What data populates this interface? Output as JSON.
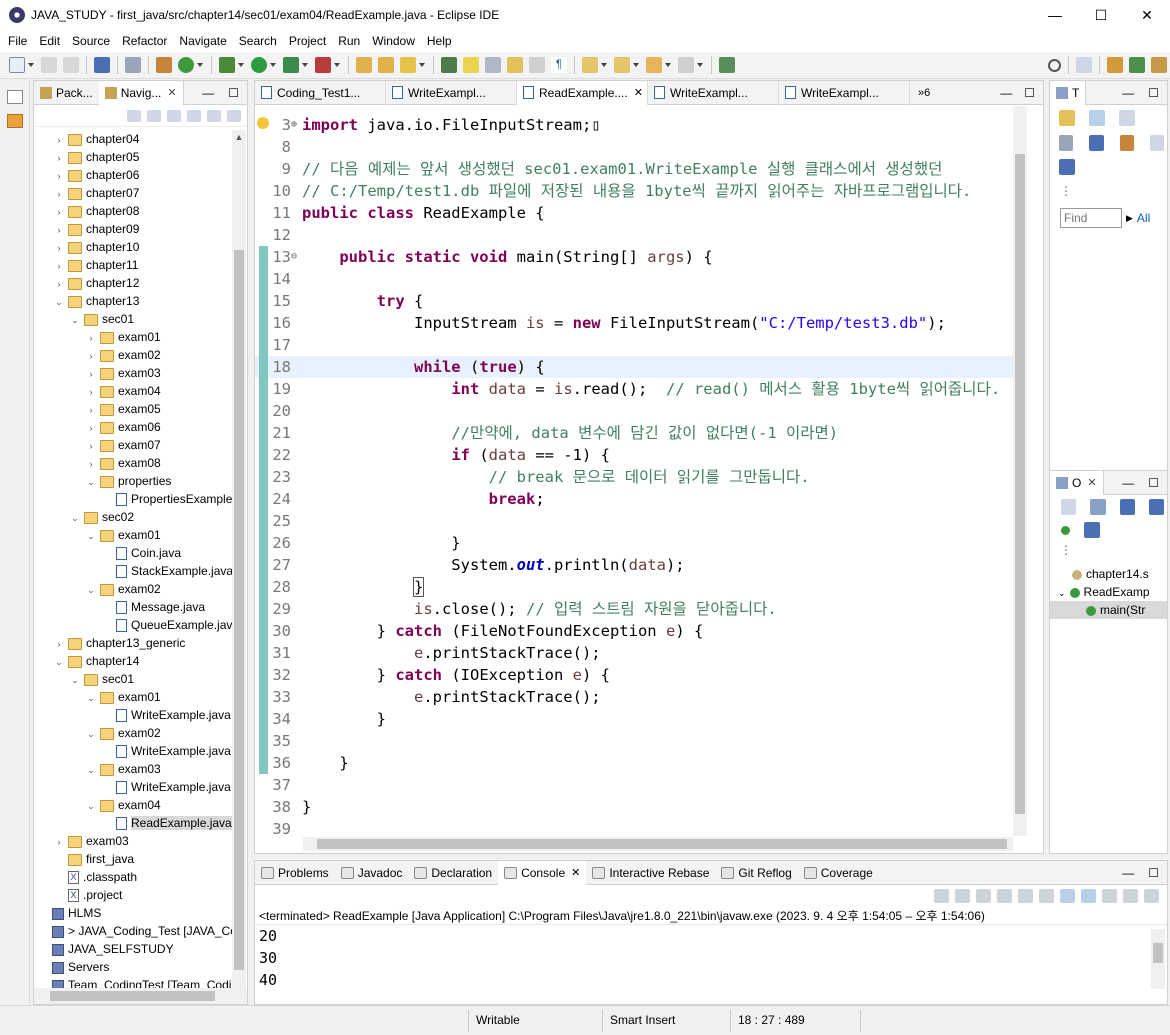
{
  "window": {
    "title": "JAVA_STUDY - first_java/src/chapter14/sec01/exam04/ReadExample.java - Eclipse IDE",
    "minimize": "—",
    "maximize": "☐",
    "close": "✕"
  },
  "menu": [
    "File",
    "Edit",
    "Source",
    "Refactor",
    "Navigate",
    "Search",
    "Project",
    "Run",
    "Window",
    "Help"
  ],
  "explorer": {
    "tabs": [
      {
        "label": "Pack..."
      },
      {
        "label": "Navig..."
      }
    ],
    "close_glyph": "✕",
    "tree": [
      {
        "label": "chapter04",
        "depth": 1,
        "type": "folder",
        "twisty": "›"
      },
      {
        "label": "chapter05",
        "depth": 1,
        "type": "folder",
        "twisty": "›"
      },
      {
        "label": "chapter06",
        "depth": 1,
        "type": "folder",
        "twisty": "›"
      },
      {
        "label": "chapter07",
        "depth": 1,
        "type": "folder",
        "twisty": "›"
      },
      {
        "label": "chapter08",
        "depth": 1,
        "type": "folder",
        "twisty": "›"
      },
      {
        "label": "chapter09",
        "depth": 1,
        "type": "folder",
        "twisty": "›"
      },
      {
        "label": "chapter10",
        "depth": 1,
        "type": "folder",
        "twisty": "›"
      },
      {
        "label": "chapter11",
        "depth": 1,
        "type": "folder",
        "twisty": "›"
      },
      {
        "label": "chapter12",
        "depth": 1,
        "type": "folder",
        "twisty": "›"
      },
      {
        "label": "chapter13",
        "depth": 1,
        "type": "folder",
        "twisty": "⌄"
      },
      {
        "label": "sec01",
        "depth": 2,
        "type": "folder",
        "twisty": "⌄"
      },
      {
        "label": "exam01",
        "depth": 3,
        "type": "folder",
        "twisty": "›"
      },
      {
        "label": "exam02",
        "depth": 3,
        "type": "folder",
        "twisty": "›"
      },
      {
        "label": "exam03",
        "depth": 3,
        "type": "folder",
        "twisty": "›"
      },
      {
        "label": "exam04",
        "depth": 3,
        "type": "folder",
        "twisty": "›"
      },
      {
        "label": "exam05",
        "depth": 3,
        "type": "folder",
        "twisty": "›"
      },
      {
        "label": "exam06",
        "depth": 3,
        "type": "folder",
        "twisty": "›"
      },
      {
        "label": "exam07",
        "depth": 3,
        "type": "folder",
        "twisty": "›"
      },
      {
        "label": "exam08",
        "depth": 3,
        "type": "folder",
        "twisty": "›"
      },
      {
        "label": "properties",
        "depth": 3,
        "type": "folder",
        "twisty": "⌄"
      },
      {
        "label": "PropertiesExample.",
        "depth": 4,
        "type": "file",
        "twisty": ""
      },
      {
        "label": "sec02",
        "depth": 2,
        "type": "folder",
        "twisty": "⌄"
      },
      {
        "label": "exam01",
        "depth": 3,
        "type": "folder",
        "twisty": "⌄"
      },
      {
        "label": "Coin.java",
        "depth": 4,
        "type": "file",
        "twisty": ""
      },
      {
        "label": "StackExample.java",
        "depth": 4,
        "type": "file",
        "twisty": ""
      },
      {
        "label": "exam02",
        "depth": 3,
        "type": "folder",
        "twisty": "⌄"
      },
      {
        "label": "Message.java",
        "depth": 4,
        "type": "file",
        "twisty": ""
      },
      {
        "label": "QueueExample.java",
        "depth": 4,
        "type": "file",
        "twisty": ""
      },
      {
        "label": "chapter13_generic",
        "depth": 1,
        "type": "folder",
        "twisty": "›"
      },
      {
        "label": "chapter14",
        "depth": 1,
        "type": "folder",
        "twisty": "⌄"
      },
      {
        "label": "sec01",
        "depth": 2,
        "type": "folder",
        "twisty": "⌄"
      },
      {
        "label": "exam01",
        "depth": 3,
        "type": "folder",
        "twisty": "⌄"
      },
      {
        "label": "WriteExample.java",
        "depth": 4,
        "type": "file",
        "twisty": ""
      },
      {
        "label": "exam02",
        "depth": 3,
        "type": "folder",
        "twisty": "⌄"
      },
      {
        "label": "WriteExample.java",
        "depth": 4,
        "type": "file",
        "twisty": ""
      },
      {
        "label": "exam03",
        "depth": 3,
        "type": "folder",
        "twisty": "⌄"
      },
      {
        "label": "WriteExample.java",
        "depth": 4,
        "type": "file",
        "twisty": ""
      },
      {
        "label": "exam04",
        "depth": 3,
        "type": "folder",
        "twisty": "⌄"
      },
      {
        "label": "ReadExample.java",
        "depth": 4,
        "type": "file",
        "twisty": "",
        "selected": true
      },
      {
        "label": "exam03",
        "depth": 1,
        "type": "folder",
        "twisty": "›"
      },
      {
        "label": "first_java",
        "depth": 1,
        "type": "folder",
        "twisty": ""
      },
      {
        "label": ".classpath",
        "depth": 1,
        "type": "xfile",
        "twisty": ""
      },
      {
        "label": ".project",
        "depth": 1,
        "type": "xfile",
        "twisty": ""
      },
      {
        "label": "HLMS",
        "depth": 0,
        "type": "project",
        "twisty": ""
      },
      {
        "label": "> JAVA_Coding_Test [JAVA_Codir",
        "depth": 0,
        "type": "project",
        "twisty": ""
      },
      {
        "label": "JAVA_SELFSTUDY",
        "depth": 0,
        "type": "project",
        "twisty": ""
      },
      {
        "label": "Servers",
        "depth": 0,
        "type": "project",
        "twisty": ""
      },
      {
        "label": "Team_CodingTest [Team_CodingT",
        "depth": 0,
        "type": "project",
        "twisty": ""
      }
    ]
  },
  "editor": {
    "tabs": [
      {
        "label": "Coding_Test1...",
        "active": false
      },
      {
        "label": "WriteExampl...",
        "active": false
      },
      {
        "label": "ReadExample....",
        "active": true
      },
      {
        "label": "WriteExampl...",
        "active": false
      },
      {
        "label": "WriteExampl...",
        "active": false
      }
    ],
    "overflow": "»6",
    "close_glyph": "✕",
    "lines": [
      {
        "n": "3",
        "marker": "⊕",
        "html": "<span class=\"kw\">import</span> java.io.FileInputStream;▯"
      },
      {
        "n": "8",
        "html": ""
      },
      {
        "n": "9",
        "html": "<span class=\"cm\">// 다음 예제는 앞서 생성했던 sec01.exam01.WriteExample 실행 클래스에서 생성했던</span>"
      },
      {
        "n": "10",
        "html": "<span class=\"cm\">// C:/Temp/test1.db 파일에 저장된 내용을 1byte씩 끝까지 읽어주는 자바프로그램입니다.</span>"
      },
      {
        "n": "11",
        "html": "<span class=\"kw\">public class</span> ReadExample {"
      },
      {
        "n": "12",
        "html": ""
      },
      {
        "n": "13",
        "marker": "⊖",
        "html": "    <span class=\"kw\">public static void</span> main(String[] <span class=\"var\">args</span>) {"
      },
      {
        "n": "14",
        "html": ""
      },
      {
        "n": "15",
        "html": "        <span class=\"kw\">try</span> {"
      },
      {
        "n": "16",
        "html": "            InputStream <span class=\"var\">is</span> = <span class=\"kw\">new</span> FileInputStream(<span class=\"str\">\"C:/Temp/test3.db\"</span>);"
      },
      {
        "n": "17",
        "html": ""
      },
      {
        "n": "18",
        "current": true,
        "html": "            <span class=\"kw\">while</span> (<span class=\"kw\">true</span>) {"
      },
      {
        "n": "19",
        "html": "                <span class=\"kw\">int</span> <span class=\"var\">data</span> = <span class=\"var\">is</span>.read();  <span class=\"cm\">// read() 메서스 활용 1byte씩 읽어줍니다.</span>"
      },
      {
        "n": "20",
        "html": ""
      },
      {
        "n": "21",
        "html": "                <span class=\"cm\">//만약에, data 변수에 담긴 값이 없다면(-1 이라면)</span>"
      },
      {
        "n": "22",
        "html": "                <span class=\"kw\">if</span> (<span class=\"var\">data</span> == -1) {"
      },
      {
        "n": "23",
        "html": "                    <span class=\"cm\">// break 문으로 데이터 읽기를 그만둡니다.</span>"
      },
      {
        "n": "24",
        "html": "                    <span class=\"kw\">break</span>;"
      },
      {
        "n": "25",
        "html": ""
      },
      {
        "n": "26",
        "html": "                }"
      },
      {
        "n": "27",
        "html": "                System.<span class=\"fld\">out</span>.println(<span class=\"var\">data</span>);"
      },
      {
        "n": "28",
        "html": "            <span style=\"outline:1px solid #555\">}</span>"
      },
      {
        "n": "29",
        "html": "            <span class=\"var\">is</span>.close(); <span class=\"cm\">// 입력 스트림 자원을 닫아줍니다.</span>"
      },
      {
        "n": "30",
        "html": "        } <span class=\"kw\">catch</span> (FileNotFoundException <span class=\"var\">e</span>) {"
      },
      {
        "n": "31",
        "html": "            <span class=\"var\">e</span>.printStackTrace();"
      },
      {
        "n": "32",
        "html": "        } <span class=\"kw\">catch</span> (IOException <span class=\"var\">e</span>) {"
      },
      {
        "n": "33",
        "html": "            <span class=\"var\">e</span>.printStackTrace();"
      },
      {
        "n": "34",
        "html": "        }"
      },
      {
        "n": "35",
        "html": ""
      },
      {
        "n": "36",
        "html": "    }"
      },
      {
        "n": "37",
        "html": ""
      },
      {
        "n": "38",
        "html": "}"
      },
      {
        "n": "39",
        "html": ""
      }
    ]
  },
  "task_view": {
    "tab_label": "T",
    "find_placeholder": "Find",
    "all_label": "All"
  },
  "outline_view": {
    "tab_label": "O",
    "items": [
      {
        "label": "chapter14.s",
        "depth": 1
      },
      {
        "label": "ReadExamp",
        "depth": 0,
        "twisty": "⌄"
      },
      {
        "label": "main(Str",
        "depth": 2,
        "selected": true
      }
    ]
  },
  "console": {
    "tabs": [
      {
        "label": "Problems",
        "active": false
      },
      {
        "label": "Javadoc",
        "active": false
      },
      {
        "label": "Declaration",
        "active": false
      },
      {
        "label": "Console",
        "active": true
      },
      {
        "label": "Interactive Rebase",
        "active": false
      },
      {
        "label": "Git Reflog",
        "active": false
      },
      {
        "label": "Coverage",
        "active": false
      }
    ],
    "terminated": "<terminated> ReadExample [Java Application] C:\\Program Files\\Java\\jre1.8.0_221\\bin\\javaw.exe  (2023. 9. 4 오후 1:54:05 – 오후 1:54:06)",
    "output": [
      "20",
      "30",
      "40"
    ]
  },
  "status": {
    "writable": "Writable",
    "insert_mode": "Smart Insert",
    "position": "18 : 27 : 489"
  }
}
